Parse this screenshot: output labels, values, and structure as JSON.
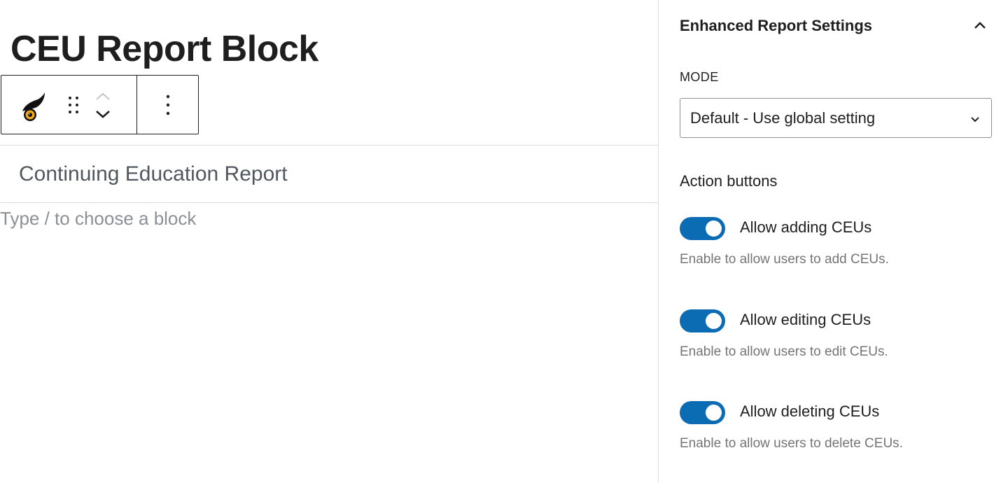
{
  "editor": {
    "block_title": "CEU Report Block",
    "report_heading": "Continuing Education Report",
    "appender_placeholder": "Type / to choose a block",
    "toolbar": {
      "icons": [
        "plugin-logo-icon",
        "drag-handle-icon",
        "chevron-up-icon",
        "chevron-down-icon",
        "more-options-icon"
      ]
    }
  },
  "sidebar": {
    "panel_title": "Enhanced Report Settings",
    "panel_expanded": true,
    "mode": {
      "label": "MODE",
      "selected": "Default - Use global setting"
    },
    "action_buttons_label": "Action buttons",
    "toggles": [
      {
        "label": "Allow adding CEUs",
        "help": "Enable to allow users to add CEUs.",
        "checked": true
      },
      {
        "label": "Allow editing CEUs",
        "help": "Enable to allow users to edit CEUs.",
        "checked": true
      },
      {
        "label": "Allow deleting CEUs",
        "help": "Enable to allow users to delete CEUs.",
        "checked": true
      }
    ]
  },
  "colors": {
    "toggle_on": "#0b6bb3",
    "text_primary": "#1e1e1e",
    "text_muted": "#757575",
    "logo_gold": "#f0a818"
  }
}
